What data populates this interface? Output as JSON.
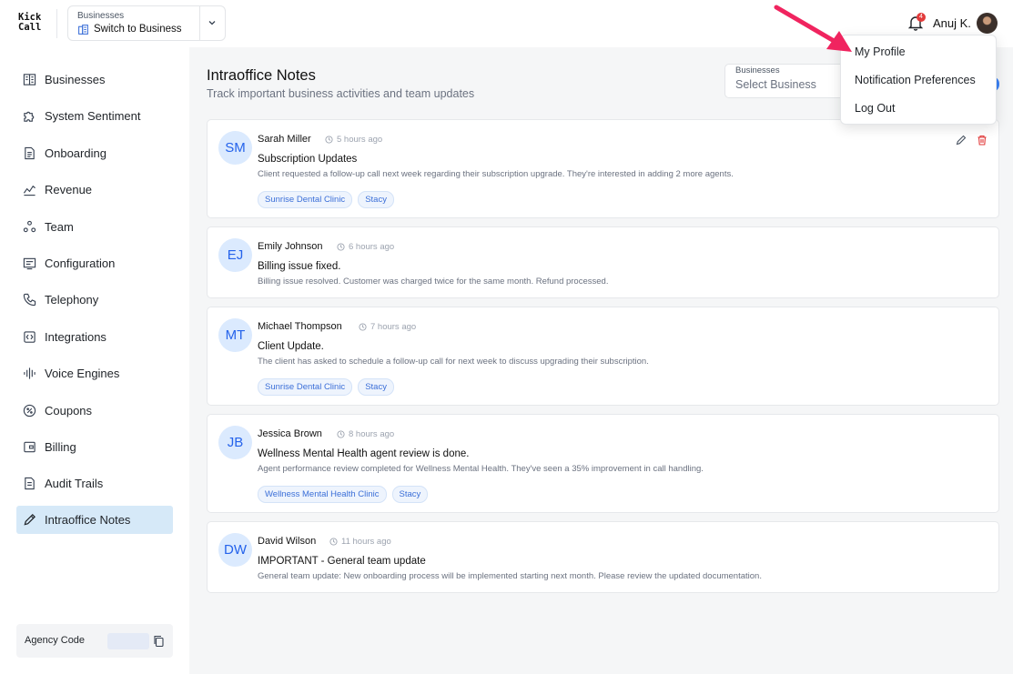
{
  "header": {
    "logo_line1": "Kick",
    "logo_line2": "Call",
    "business_switch": {
      "label": "Businesses",
      "value": "Switch to Business"
    },
    "notification_count": "4",
    "user_name": "Anuj K."
  },
  "sidebar": {
    "items": [
      {
        "label": "Businesses",
        "icon": "building-icon"
      },
      {
        "label": "System Sentiment",
        "icon": "puzzle-icon"
      },
      {
        "label": "Onboarding",
        "icon": "document-icon"
      },
      {
        "label": "Revenue",
        "icon": "trend-chart-icon"
      },
      {
        "label": "Team",
        "icon": "team-icon"
      },
      {
        "label": "Configuration",
        "icon": "terminal-icon"
      },
      {
        "label": "Telephony",
        "icon": "phone-icon"
      },
      {
        "label": "Integrations",
        "icon": "code-icon"
      },
      {
        "label": "Voice Engines",
        "icon": "waveform-icon"
      },
      {
        "label": "Coupons",
        "icon": "coupon-icon"
      },
      {
        "label": "Billing",
        "icon": "wallet-icon"
      },
      {
        "label": "Audit Trails",
        "icon": "audit-icon"
      },
      {
        "label": "Intraoffice Notes",
        "icon": "pencil-icon",
        "active": true
      }
    ],
    "agency_code_label": "Agency Code"
  },
  "main": {
    "title": "Intraoffice Notes",
    "subtitle": "Track important business activities and team updates",
    "filter": {
      "label": "Businesses",
      "placeholder": "Select Business"
    },
    "notes": [
      {
        "initials": "SM",
        "author": "Sarah Miller",
        "time": "5 hours ago",
        "title": "Subscription Updates",
        "body": "Client requested a follow-up call next week regarding their subscription upgrade. They're interested in adding 2 more agents.",
        "tags": [
          "Sunrise Dental Clinic",
          "Stacy"
        ]
      },
      {
        "initials": "EJ",
        "author": "Emily Johnson",
        "time": "6 hours ago",
        "title": "Billing issue fixed.",
        "body": "Billing issue resolved. Customer was charged twice for the same month. Refund processed.",
        "tags": []
      },
      {
        "initials": "MT",
        "author": "Michael Thompson",
        "time": "7 hours ago",
        "title": "Client Update.",
        "body": "The client has asked to schedule a follow-up call for next week to discuss upgrading their subscription.",
        "tags": [
          "Sunrise Dental Clinic",
          "Stacy"
        ]
      },
      {
        "initials": "JB",
        "author": "Jessica Brown",
        "time": "8 hours ago",
        "title": "Wellness Mental Health agent review is done.",
        "body": "Agent performance review completed for Wellness Mental Health. They've seen a 35% improvement in call handling.",
        "tags": [
          "Wellness Mental Health Clinic",
          "Stacy"
        ]
      },
      {
        "initials": "DW",
        "author": "David Wilson",
        "time": "11 hours ago",
        "title": "IMPORTANT - General team update",
        "body": "General team update: New onboarding process will be implemented starting next month. Please review the updated documentation.",
        "tags": []
      }
    ]
  },
  "profile_menu": {
    "items": [
      "My Profile",
      "Notification Preferences",
      "Log Out"
    ]
  },
  "colors": {
    "accent": "#2563eb",
    "active_nav": "#d6e9f8",
    "annotation_arrow": "#f0245f",
    "danger": "#e23b3b"
  }
}
